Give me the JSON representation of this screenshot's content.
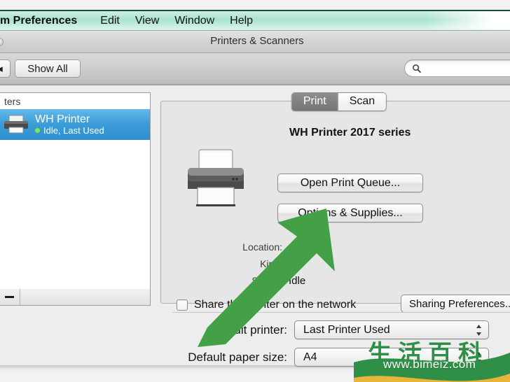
{
  "menubar": {
    "items": [
      {
        "label": "m Preferences",
        "bold": true
      },
      {
        "label": "Edit",
        "bold": false
      },
      {
        "label": "View",
        "bold": false
      },
      {
        "label": "Window",
        "bold": false
      },
      {
        "label": "Help",
        "bold": false
      }
    ]
  },
  "window": {
    "title": "Printers & Scanners",
    "toolbar": {
      "back_label": "◂",
      "show_all_label": "Show All",
      "search_placeholder": "",
      "search_value": ""
    }
  },
  "sidebar": {
    "header": "ters",
    "printers": [
      {
        "name": "WH Printer",
        "status": "Idle, Last Used",
        "status_color": "#7ee06a",
        "selected": true
      }
    ],
    "footer": {
      "remove_label": "−"
    }
  },
  "detail": {
    "tabs": [
      {
        "label": "Print",
        "selected": true
      },
      {
        "label": "Scan",
        "selected": false
      }
    ],
    "device_title": "WH Printer 2017 series",
    "buttons": {
      "open_print_queue": "Open Print Queue...",
      "options_supplies": "Options & Supplies...",
      "sharing_preferences": "Sharing Preferences..."
    },
    "info": {
      "location_label": "Location:",
      "location_value": "",
      "kind_label": "Kind:",
      "kind_value": "",
      "status_label": "Status:",
      "status_value": "Idle"
    },
    "share": {
      "label": "Share this printer on the network",
      "checked": false
    }
  },
  "bottom": {
    "default_printer_label": "Default printer:",
    "default_printer_value": "Last Printer Used",
    "default_paper_label": "Default paper size:",
    "default_paper_value": "A4"
  },
  "annotation": {
    "arrow_color": "#43a047",
    "arrow_target": "options-supplies-button"
  },
  "watermark": {
    "cn_text": "生活百科",
    "url": "www.bimeiz.com",
    "green": "#2f8f46",
    "yellow": "#e8b43a"
  }
}
